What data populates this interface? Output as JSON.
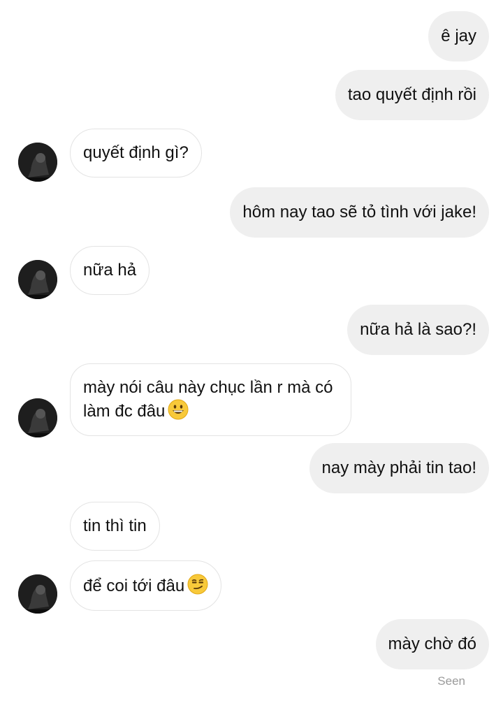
{
  "messages": [
    {
      "id": "m1",
      "from": "me",
      "text": "ê jay"
    },
    {
      "id": "m2",
      "from": "me",
      "text": "tao quyết định rồi"
    },
    {
      "id": "m3",
      "from": "them",
      "text": "quyết định gì?"
    },
    {
      "id": "m4",
      "from": "me",
      "text": "hôm nay tao sẽ tỏ tình với jake!"
    },
    {
      "id": "m5",
      "from": "them",
      "text": "nữa hả"
    },
    {
      "id": "m6",
      "from": "me",
      "text": "nữa hả là sao?!"
    },
    {
      "id": "m7",
      "from": "them",
      "text": "mày nói câu này chục lần r mà có làm đc đâu",
      "emoji": "grinning-face-emoji"
    },
    {
      "id": "m8",
      "from": "me",
      "text": "nay mày phải tin tao!"
    },
    {
      "id": "m9",
      "from": "them",
      "text": "tin thì tin"
    },
    {
      "id": "m10",
      "from": "them",
      "text": "để coi tới đâu",
      "emoji": "smirking-face-emoji"
    },
    {
      "id": "m11",
      "from": "me",
      "text": "mày chờ đó"
    }
  ],
  "status": {
    "seen_label": "Seen"
  },
  "colors": {
    "outgoing_bubble": "#efefef",
    "incoming_border": "#e3e3e3",
    "seen_text": "#9a9a9a",
    "emoji_yellow": "#f8c93a"
  }
}
